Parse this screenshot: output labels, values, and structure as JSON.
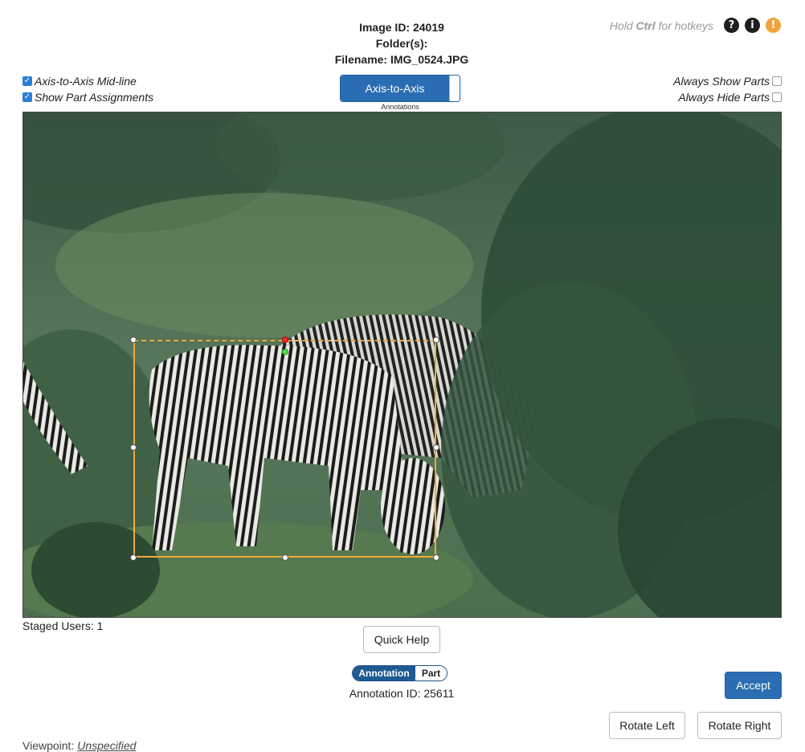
{
  "header": {
    "image_id": "Image ID: 24019",
    "folders": "Folder(s):",
    "filename": "Filename: IMG_0524.JPG"
  },
  "hotkeys": {
    "hint_prefix": "Hold",
    "hint_key": "Ctrl",
    "hint_suffix": "for hotkeys",
    "help_icon": "question-circle-icon",
    "info_icon": "info-circle-icon",
    "warning_icon": "exclamation-circle-icon",
    "warning_color": "#f0a33a"
  },
  "options": {
    "axis_midline": {
      "label": "Axis-to-Axis Mid-line",
      "checked": true
    },
    "show_part_assignments": {
      "label": "Show Part Assignments",
      "checked": true
    },
    "always_show_parts": {
      "label": "Always Show Parts",
      "checked": false
    },
    "always_hide_parts": {
      "label": "Always Hide Parts",
      "checked": false
    }
  },
  "mode_toggle": {
    "label": "Axis-to-Axis",
    "sublabel": "Annotations",
    "accent": "#2a6db2"
  },
  "image": {
    "subject": "photo of zebras grazing in green bush",
    "bbox_color": "#f0a93a"
  },
  "footer": {
    "staged_users": "Staged Users: 1",
    "quick_help": "Quick Help",
    "toggle_annotation": "Annotation",
    "toggle_part": "Part",
    "annotation_id": "Annotation ID: 25611",
    "accept": "Accept",
    "rotate_left": "Rotate Left",
    "rotate_right": "Rotate Right",
    "viewpoint_label": "Viewpoint:",
    "viewpoint_value": "Unspecified"
  }
}
